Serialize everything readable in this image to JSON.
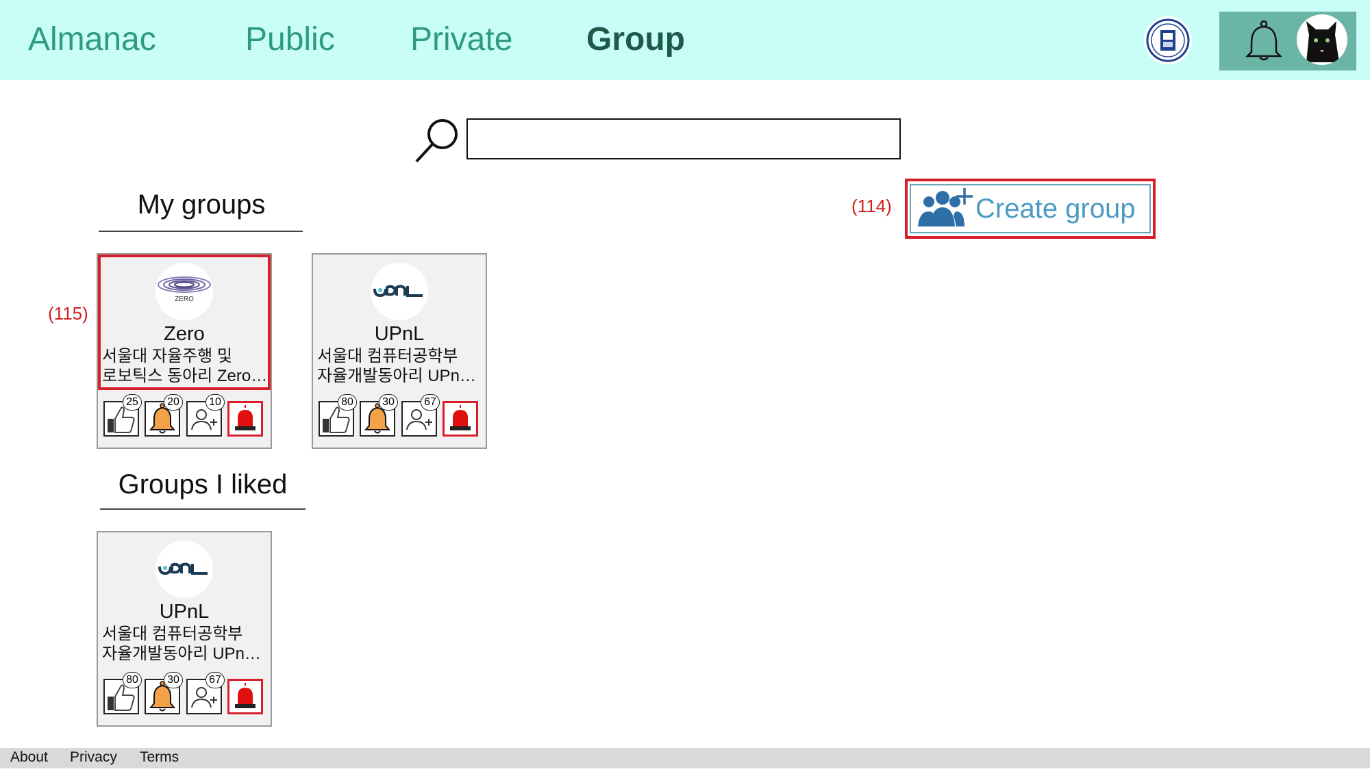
{
  "nav": {
    "items": [
      {
        "label": "Almanac",
        "active": false
      },
      {
        "label": "Public",
        "active": false
      },
      {
        "label": "Private",
        "active": false
      },
      {
        "label": "Group",
        "active": true
      }
    ]
  },
  "header": {
    "emblem_icon": "university-emblem-icon",
    "notification_icon": "bell-icon",
    "avatar_icon": "black-cat-avatar"
  },
  "search": {
    "placeholder": "",
    "value": ""
  },
  "my_groups": {
    "title": "My groups",
    "annotation": "(115)",
    "groups": [
      {
        "name": "Zero",
        "desc_line1": "서울대 자율주행 및",
        "desc_line2": "로보틱스 동아리 Zero입니다",
        "logo_text": "ZERO",
        "likes": "25",
        "notifications": "20",
        "members": "10"
      },
      {
        "name": "UPnL",
        "desc_line1": "서울대 컴퓨터공학부",
        "desc_line2": "자율개발동아리 UPnL입니다",
        "logo_text": "upnl",
        "likes": "80",
        "notifications": "30",
        "members": "67"
      }
    ]
  },
  "create_group": {
    "label": "Create group",
    "annotation": "(114)"
  },
  "liked_groups": {
    "title": "Groups I liked",
    "groups": [
      {
        "name": "UPnL",
        "desc_line1": "서울대 컴퓨터공학부",
        "desc_line2": "자율개발동아리 UPnL입니다",
        "logo_text": "upnl",
        "likes": "80",
        "notifications": "30",
        "members": "67"
      }
    ]
  },
  "footer": {
    "about": "About",
    "privacy": "Privacy",
    "terms": "Terms"
  },
  "colors": {
    "header_bg": "#c8fdf8",
    "nav_text": "#2e9a80",
    "highlight": "#d91e2b",
    "create_text": "#4a9ac4"
  }
}
